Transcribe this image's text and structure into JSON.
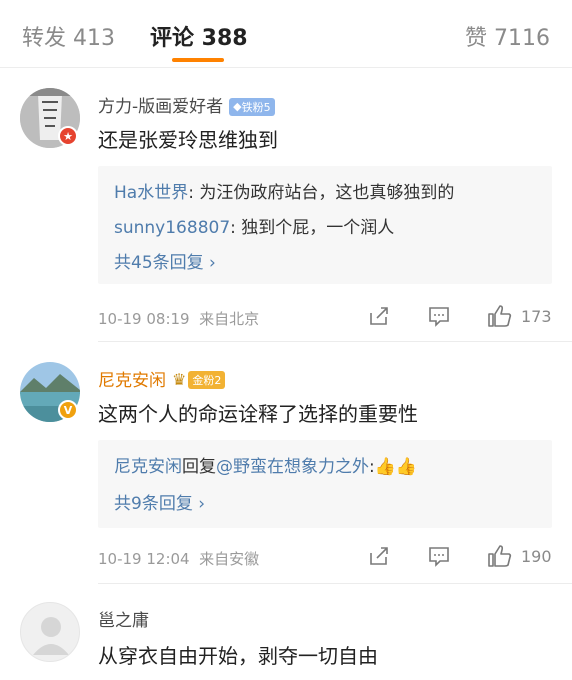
{
  "tabs": {
    "repost": "转发 413",
    "comments": "评论 388",
    "likes": "赞 7116"
  },
  "comments": [
    {
      "username": "方力-版画爱好者",
      "badge": "铁粉5",
      "text": "还是张爱玲思维独到",
      "replies": [
        {
          "user": "Ha水世界",
          "text": ": 为汪伪政府站台，这也真够独到的"
        },
        {
          "user": "sunny168807",
          "text": ": 独到个屁，一个润人"
        }
      ],
      "more_replies": "共45条回复 ›",
      "time": "10-19 08:19",
      "source": "来自北京",
      "like_count": "173"
    },
    {
      "username": "尼克安闲",
      "badge": "金粉2",
      "text": "这两个人的命运诠释了选择的重要性",
      "replies": [
        {
          "user": "尼克安闲",
          "text": "回复",
          "mention": "@野蛮在想象力之外",
          "emoji": ":👍👍"
        }
      ],
      "more_replies": "共9条回复 ›",
      "time": "10-19 12:04",
      "source": "来自安徽",
      "like_count": "190"
    },
    {
      "username": "邕之庸",
      "text": "从穿衣自由开始，剥夺一切自由"
    }
  ],
  "colors": {
    "accent": "#ff8200",
    "link": "#4f7cac",
    "gold_username": "#e07a00"
  }
}
